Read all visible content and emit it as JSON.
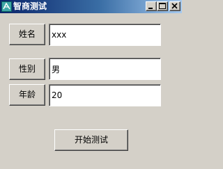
{
  "window": {
    "title": "智商测试",
    "icon": "app-icon"
  },
  "caption_buttons": {
    "minimize_icon": "minimize-icon",
    "maximize_icon": "maximize-icon",
    "close_icon": "close-icon"
  },
  "form": {
    "name": {
      "label": "姓名",
      "value": "xxx"
    },
    "gender": {
      "label": "性别",
      "value": "男"
    },
    "age": {
      "label": "年龄",
      "value": "20"
    }
  },
  "actions": {
    "start_label": "开始测试"
  },
  "colors": {
    "titlebar_start": "#0a246a",
    "titlebar_end": "#a6caf0",
    "face": "#d4d0c8"
  }
}
